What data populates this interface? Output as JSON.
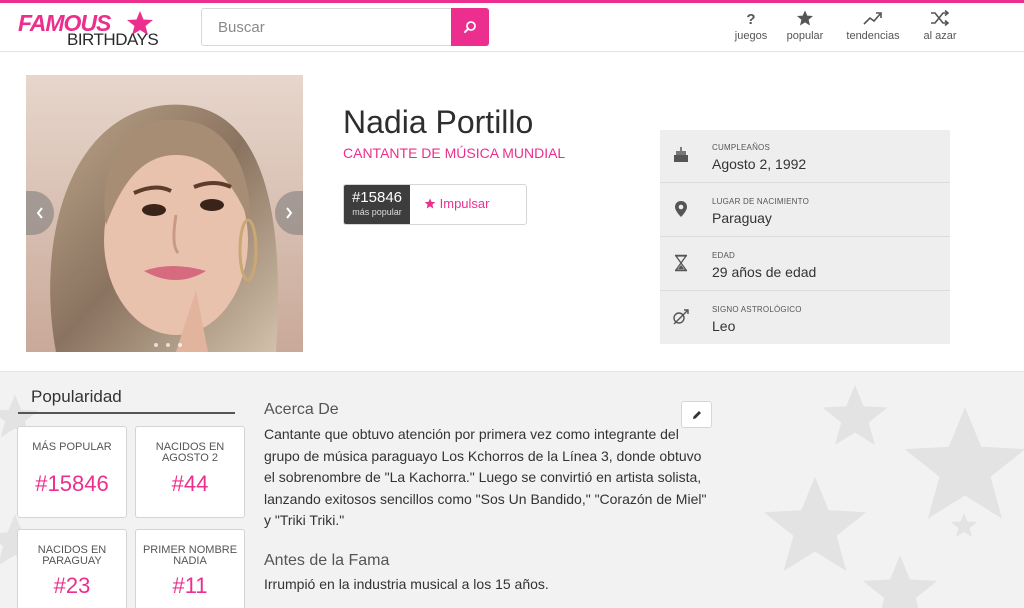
{
  "header": {
    "logo_famous": "FAMOUS",
    "logo_birthdays": "BIRTHDAYS",
    "search_placeholder": "Buscar",
    "nav": [
      {
        "label": "juegos",
        "icon": "question-icon"
      },
      {
        "label": "popular",
        "icon": "star-icon"
      },
      {
        "label": "tendencias",
        "icon": "trending-icon"
      },
      {
        "label": "al azar",
        "icon": "shuffle-icon"
      }
    ]
  },
  "profile": {
    "name": "Nadia Portillo",
    "occupation": "CANTANTE DE MÚSICA MUNDIAL",
    "rank": "#15846",
    "rank_sub": "más popular",
    "boost_label": "Impulsar"
  },
  "facts": [
    {
      "label": "CUMPLEAÑOS",
      "value": "Agosto 2, 1992",
      "icon": "cake-icon"
    },
    {
      "label": "LUGAR DE NACIMIENTO",
      "value": "Paraguay",
      "icon": "location-pin-icon"
    },
    {
      "label": "EDAD",
      "value": "29 años de edad",
      "icon": "hourglass-icon"
    },
    {
      "label": "SIGNO ASTROLÓGICO",
      "value": "Leo",
      "icon": "leo-sign-icon"
    }
  ],
  "popularity": {
    "title": "Popularidad",
    "stats": [
      {
        "label": "MÁS POPULAR",
        "value": "#15846"
      },
      {
        "label": "NACIDOS EN AGOSTO 2",
        "value": "#44"
      },
      {
        "label": "NACIDOS EN PARAGUAY",
        "value": "#23"
      },
      {
        "label": "PRIMER NOMBRE NADIA",
        "value": "#11"
      }
    ]
  },
  "about": {
    "title": "Acerca De",
    "text": "Cantante que obtuvo atención por primera vez como integrante del grupo de música paraguayo Los Kchorros de la Línea 3, donde obtuvo el sobrenombre de \"La Kachorra.\" Luego se convirtió en artista solista, lanzando exitosos sencillos como \"Sos Un Bandido,\" \"Corazón de Miel\" y \"Triki Triki.\"",
    "before_title": "Antes de la Fama",
    "before_text": "Irrumpió en la industria musical a los 15 años."
  },
  "colors": {
    "accent": "#ec2f8e",
    "dark": "#3d3d3d",
    "panel": "#eeeeee"
  }
}
